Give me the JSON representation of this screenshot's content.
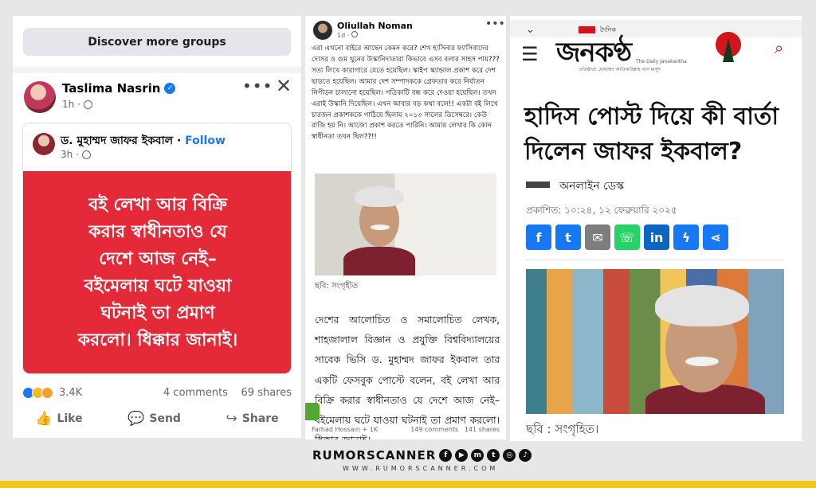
{
  "colors": {
    "brand_blue": "#1877f2",
    "alert_red": "#e42a39",
    "footer_yellow": "#f5c518",
    "janakantha_red": "#d1151b"
  },
  "facebook_post": {
    "discover_button": "Discover more groups",
    "author": "Taslima Nasrin",
    "time": "1h",
    "shared": {
      "author": "ড. মুহাম্মদ জাফর ইকবাল",
      "follow": "Follow",
      "time": "3h",
      "card_lines": [
        "বই লেখা আর বিক্রি",
        "করার স্বাধীনতাও যে",
        "দেশে আজ নেই–",
        "বইমেলায় ঘটে যাওয়া",
        "ঘটনাই তা প্রমাণ",
        "করলো। ধিক্কার জানাই।"
      ]
    },
    "reactions_count": "3.4K",
    "comments": "4 comments",
    "shares": "69 shares",
    "actions": {
      "like": "Like",
      "send": "Send",
      "share": "Share"
    }
  },
  "noman_post": {
    "author": "Oliullah Noman",
    "time": "1d · ",
    "text": "এরা এখনো বাইরে আছেন কেমন করে? শেখ হাসিনার ফ্যাসিবাদের দোসর ও গুম খুনের উস্কানিদাতারা কিভাবে এসব বলার সাহস পায়??? সত্য লিখে কারাগারে যেতে হয়েছিল। স্কাইপ স্ক্যান্ডাল প্রকাশ করে দেশ ছাড়তে হয়েছিল। আমার দেশ সম্পাদককে গ্রেফতার করে নির্যাতন নিপীড়ন চালানো হয়েছিল। পত্রিকাটি বন্ধ করে দেওয়া হয়েছিল। তখন এরাই উস্কানি দিয়েছিল। এখন আবার বড় কথা বলে!! একটা বই লিখে চারজন প্রকাশককে পাঠিয়ে ছিলাম ২০১৩ সালের ডিসেম্বরে। কেউ রাজি হয় নি। আজো প্রকাশ করতে পারিনি। আমার লেখার কি কোন স্বাধীনতা তখন ছিল??!!",
    "photo_caption": "ছবি: সংগৃহীত",
    "article": "দেশের আলোচিত ও সমালোচিত লেখক, শাহজালাল বিজ্ঞান ও প্রযুক্তি বিশ্ববিদ্যালয়ের সাবেক ভিসি ড. মুহাম্মদ জাফর ইকবাল তার একটি ফেসবুক পোস্টে বলেন, বই লেখা আর বিক্রি করার স্বাধীনতাও যে দেশে আজ নেই– বইমেলায় ঘটে যাওয়া ঘটনাই তা প্রমাণ করলো। ধিক্কার জানাই।",
    "reactors": "Farhad Hossain + 1K",
    "comments": "149 comments",
    "shares": "141 shares"
  },
  "janakantha": {
    "logo_tagline_top": "দৈনিক",
    "logo_title": "জনকণ্ঠ",
    "logo_sub": "প্রতিষ্ঠাতা মোহাম্মদ আতিকউল্লাহ খান মাসুদ",
    "logo_sub2": "The Daily Janakantha",
    "headline": "হাদিস পোস্ট দিয়ে কী বার্তা দিলেন জাফর ইকবাল?",
    "desk": "অনলাইন ডেস্ক",
    "published": "প্রকাশিত: ১০:২৪, ১২ ফেব্রুয়ারি ২০২৫",
    "share_icons": [
      "facebook-icon",
      "twitter-icon",
      "email-icon",
      "whatsapp-icon",
      "linkedin-icon",
      "messenger-icon",
      "share-icon"
    ],
    "photo_caption": "ছবি : সংগৃহিত।"
  },
  "footer": {
    "brand": "RUMORSCANNER",
    "website": "WWW.RUMORSCANNER.COM"
  }
}
